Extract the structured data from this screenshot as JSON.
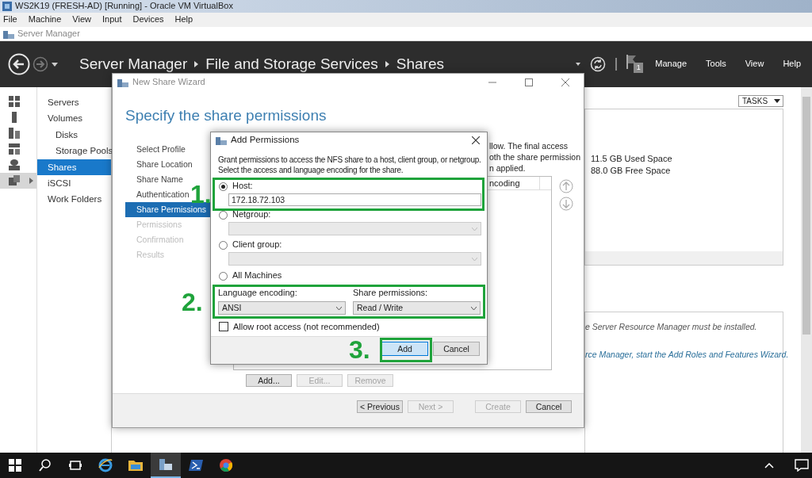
{
  "vm_window": {
    "title": "WS2K19 (FRESH-AD) [Running] - Oracle VM VirtualBox",
    "menu": [
      "File",
      "Machine",
      "View",
      "Input",
      "Devices",
      "Help"
    ]
  },
  "server_manager": {
    "title": "Server Manager",
    "breadcrumb": [
      "Server Manager",
      "File and Storage Services",
      "Shares"
    ],
    "notification_count": "1",
    "menu": [
      "Manage",
      "Tools",
      "View",
      "Help"
    ],
    "tool_icons": [
      {
        "kind": "dashboard",
        "selected": false
      },
      {
        "kind": "local-server",
        "selected": false
      },
      {
        "kind": "all-servers",
        "selected": false
      },
      {
        "kind": "roles",
        "selected": false
      },
      {
        "kind": "storage",
        "selected": false
      },
      {
        "kind": "file-services",
        "selected": true
      }
    ],
    "nav": [
      {
        "label": "Servers",
        "selected": false
      },
      {
        "label": "Volumes",
        "selected": false,
        "children": [
          {
            "label": "Disks",
            "selected": false
          },
          {
            "label": "Storage Pools",
            "selected": false
          }
        ]
      },
      {
        "label": "Shares",
        "selected": true
      },
      {
        "label": "iSCSI",
        "selected": false
      },
      {
        "label": "Work Folders",
        "selected": false
      }
    ],
    "tasks_button": "TASKS",
    "volume_info": [
      "11.5 GB Used Space",
      "88.0 GB Free Space"
    ],
    "notices": [
      {
        "text": "e Server Resource Manager must be installed.",
        "kind": "note"
      },
      {
        "text": "rce Manager, start the Add Roles and Features Wizard.",
        "kind": "link"
      }
    ]
  },
  "wizard": {
    "title": "New Share Wizard",
    "heading": "Specify the share permissions",
    "steps": [
      {
        "label": "Select Profile",
        "selected": false,
        "disabled": false
      },
      {
        "label": "Share Location",
        "selected": false,
        "disabled": false
      },
      {
        "label": "Share Name",
        "selected": false,
        "disabled": false
      },
      {
        "label": "Authentication",
        "selected": false,
        "disabled": false
      },
      {
        "label": "Share Permissions",
        "selected": true,
        "disabled": false
      },
      {
        "label": "Permissions",
        "selected": false,
        "disabled": true
      },
      {
        "label": "Confirmation",
        "selected": false,
        "disabled": true
      },
      {
        "label": "Results",
        "selected": false,
        "disabled": true
      }
    ],
    "description_lines": [
      "llow. The final access",
      "oth the share permission",
      "n applied."
    ],
    "table_column": "ncoding",
    "list_buttons": [
      {
        "label": "Add...",
        "disabled": false
      },
      {
        "label": "Edit...",
        "disabled": true
      },
      {
        "label": "Remove",
        "disabled": true
      }
    ],
    "footer_buttons": [
      {
        "label": "< Previous",
        "disabled": false
      },
      {
        "label": "Next >",
        "disabled": true
      },
      {
        "label": "Create",
        "disabled": true
      },
      {
        "label": "Cancel",
        "disabled": false
      }
    ]
  },
  "dialog": {
    "title": "Add Permissions",
    "description": "Grant permissions to access the NFS share to a host, client group, or netgroup.\nSelect the access and language encoding for the share.",
    "options": [
      {
        "label": "Host:",
        "selected": true,
        "kind": "text",
        "value": "172.18.72.103"
      },
      {
        "label": "Netgroup:",
        "selected": false,
        "kind": "dropdown"
      },
      {
        "label": "Client group:",
        "selected": false,
        "kind": "dropdown"
      },
      {
        "label": "All Machines",
        "selected": false,
        "kind": "none"
      }
    ],
    "language_encoding": {
      "label": "Language encoding:",
      "value": "ANSI"
    },
    "share_permissions": {
      "label": "Share permissions:",
      "value": "Read / Write"
    },
    "allow_root": {
      "label": "Allow root access (not recommended)",
      "checked": false
    },
    "buttons": [
      {
        "label": "Add",
        "kind": "default"
      },
      {
        "label": "Cancel",
        "kind": "normal"
      }
    ]
  },
  "annotations": [
    {
      "label": "1."
    },
    {
      "label": "2."
    },
    {
      "label": "3."
    }
  ],
  "taskbar": {
    "items": [
      {
        "kind": "start",
        "selected": false
      },
      {
        "kind": "search",
        "selected": false
      },
      {
        "kind": "task-view",
        "selected": false
      },
      {
        "kind": "ie",
        "selected": false
      },
      {
        "kind": "explorer",
        "selected": false
      },
      {
        "kind": "server-manager",
        "selected": true
      },
      {
        "kind": "powershell",
        "selected": false
      },
      {
        "kind": "chrome",
        "selected": false
      }
    ]
  }
}
